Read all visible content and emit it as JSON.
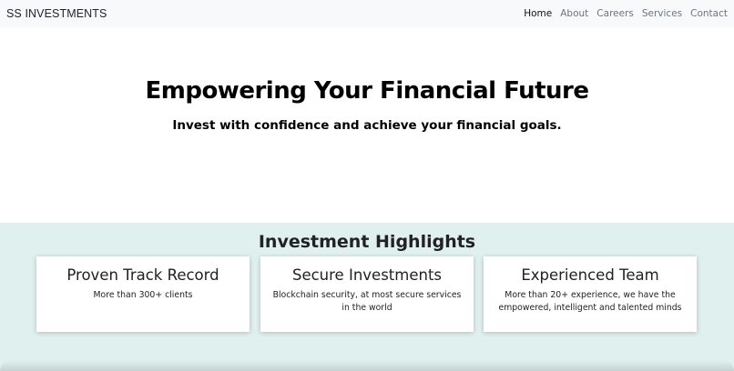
{
  "navbar": {
    "brand": "SS INVESTMENTS",
    "links": [
      {
        "label": "Home",
        "active": true
      },
      {
        "label": "About",
        "active": false
      },
      {
        "label": "Careers",
        "active": false
      },
      {
        "label": "Services",
        "active": false
      },
      {
        "label": "Contact",
        "active": false
      }
    ]
  },
  "hero": {
    "title": "Empowering Your Financial Future",
    "subtitle": "Invest with confidence and achieve your financial goals."
  },
  "highlights": {
    "title": "Investment Highlights",
    "cards": [
      {
        "title": "Proven Track Record",
        "text": "More than 300+ clients"
      },
      {
        "title": "Secure Investments",
        "text": "Blockchain security, at most secure services in the world"
      },
      {
        "title": "Experienced Team",
        "text": "More than 20+ experience, we have the empowered, intelligent and talented minds"
      }
    ]
  },
  "colors": {
    "navbar_bg": "#f8f9fa",
    "highlights_bg": "#e0f0ef"
  }
}
